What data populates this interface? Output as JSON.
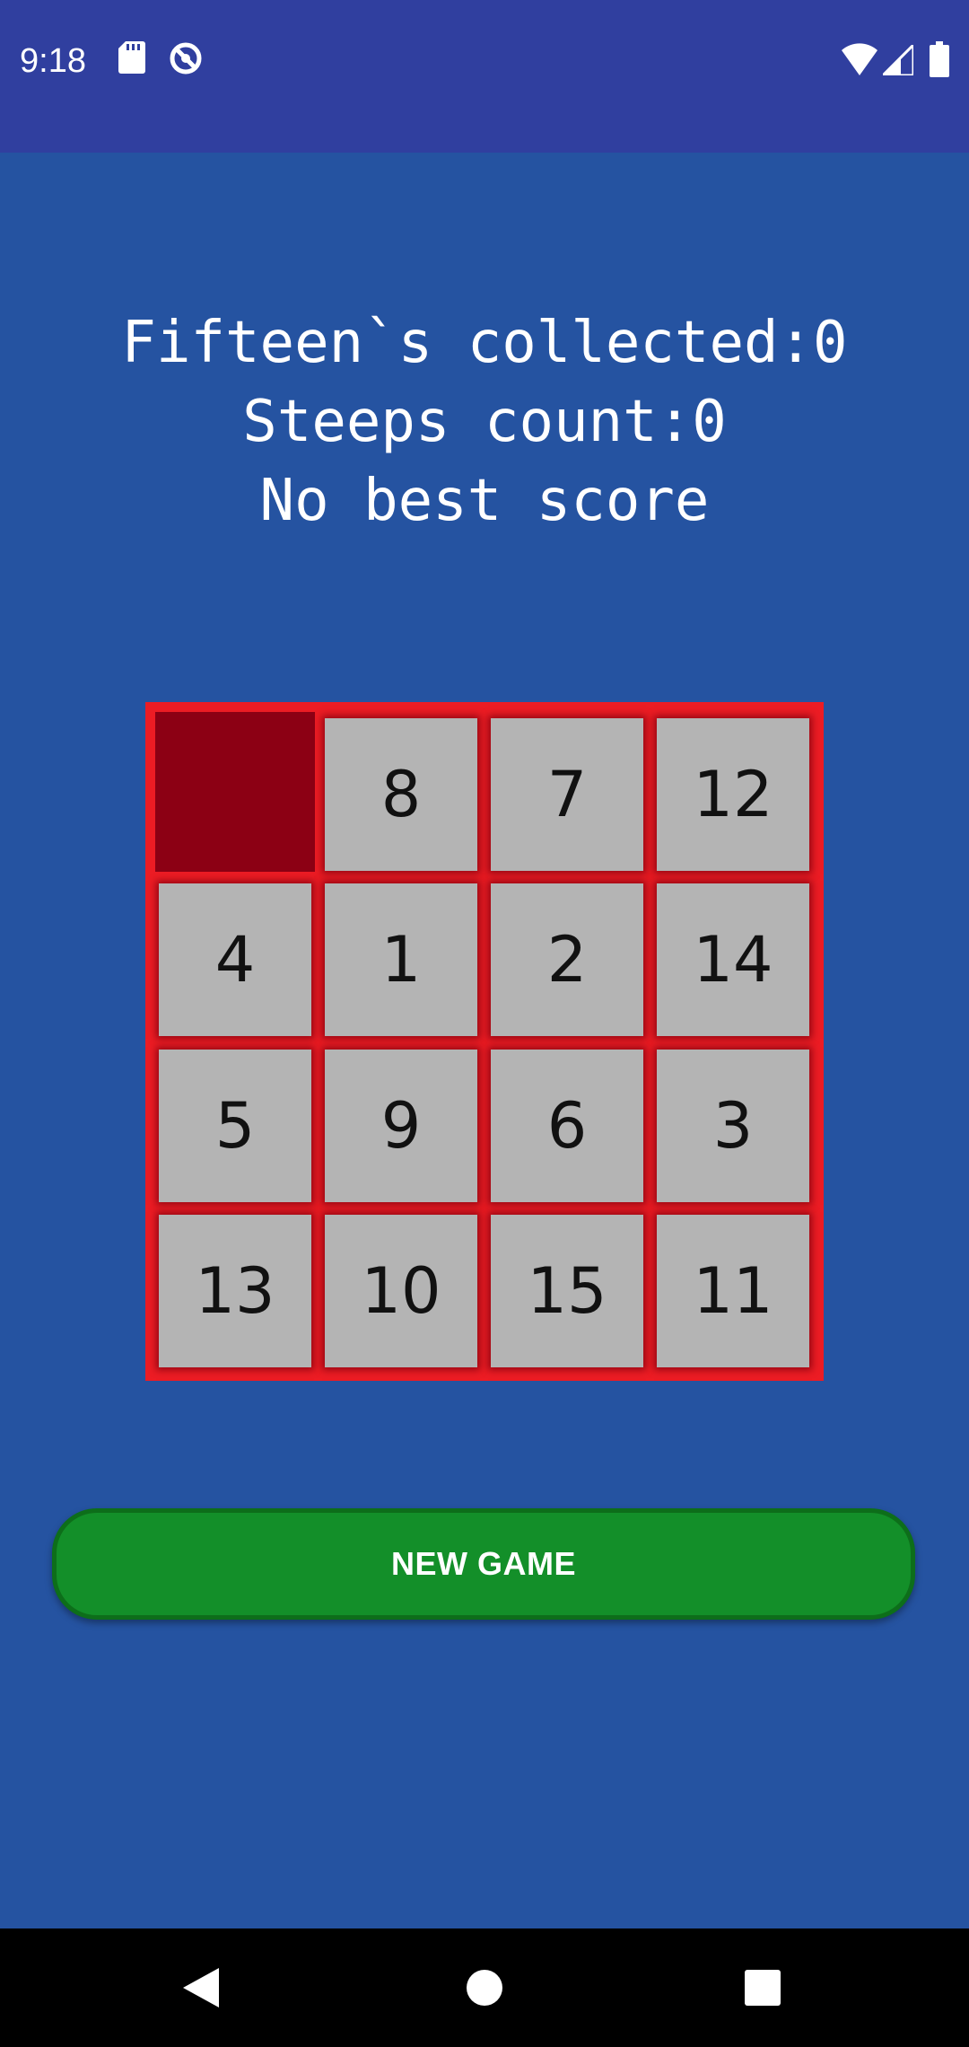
{
  "status_bar": {
    "time": "9:18",
    "icons_left": [
      "sd-card-icon",
      "no-disturb-icon"
    ],
    "icons_right": [
      "wifi-icon",
      "signal-icon",
      "battery-icon"
    ],
    "background": "#303f9f"
  },
  "score": {
    "collected_line": "Fifteen`s collected:0",
    "steps_line": "Steeps count:0",
    "best_line": "No best score"
  },
  "board": {
    "background": "#ec1c24",
    "tile_color": "#b4b4b4",
    "empty_color": "#8c0014",
    "rows": [
      [
        "",
        "8",
        "7",
        "12"
      ],
      [
        "4",
        "1",
        "2",
        "14"
      ],
      [
        "5",
        "9",
        "6",
        "3"
      ],
      [
        "13",
        "10",
        "15",
        "11"
      ]
    ]
  },
  "new_game_button": {
    "label": "NEW GAME",
    "color": "#138f29"
  },
  "nav_bar": {
    "buttons": [
      "back-icon",
      "home-icon",
      "recents-icon"
    ]
  },
  "page_background": "#2553a1"
}
